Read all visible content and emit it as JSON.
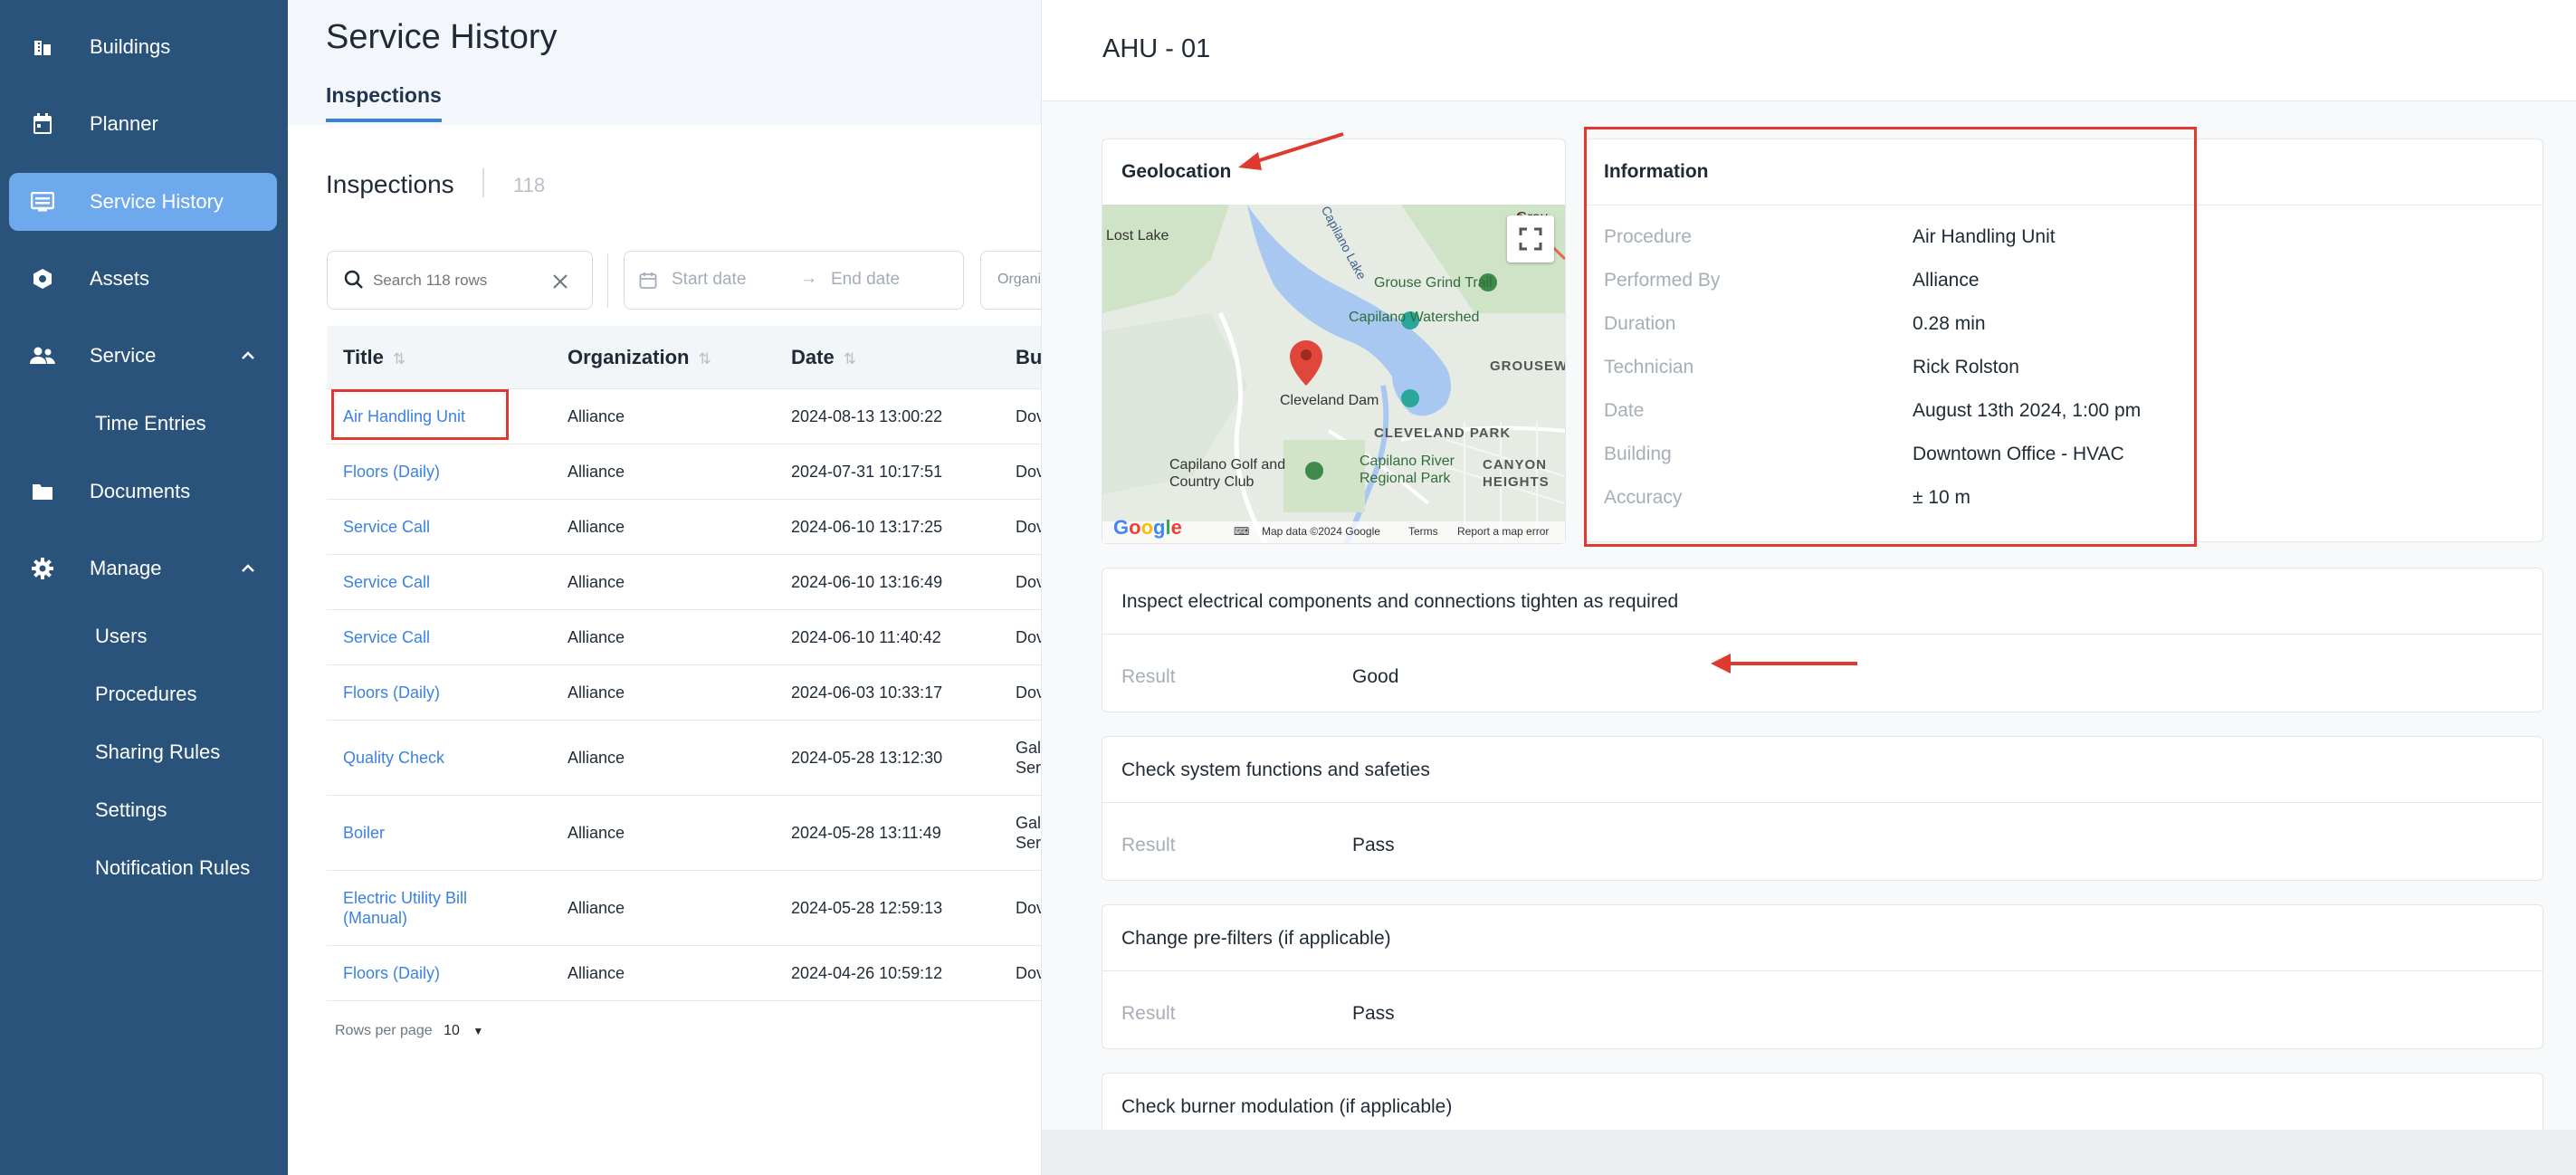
{
  "sidebar": {
    "items": [
      {
        "label": "Buildings",
        "icon": "building-icon"
      },
      {
        "label": "Planner",
        "icon": "calendar-icon"
      },
      {
        "label": "Service History",
        "icon": "history-icon",
        "active": true
      },
      {
        "label": "Assets",
        "icon": "asset-icon"
      },
      {
        "label": "Service",
        "icon": "people-icon",
        "expanded": true
      },
      {
        "label": "Documents",
        "icon": "folder-icon"
      },
      {
        "label": "Manage",
        "icon": "gear-icon",
        "expanded": true
      }
    ],
    "service_sub": [
      "Time Entries"
    ],
    "manage_sub": [
      "Users",
      "Procedures",
      "Sharing Rules",
      "Settings",
      "Notification Rules"
    ],
    "active_color": "#6ea9ee",
    "background": "#2a537c"
  },
  "header": {
    "title": "Service History",
    "tab": "Inspections"
  },
  "list": {
    "title": "Inspections",
    "count": "118",
    "search_placeholder": "Search 118 rows",
    "start_date_placeholder": "Start date",
    "end_date_placeholder": "End date",
    "org_filter": "Organi",
    "columns": [
      "Title",
      "Organization",
      "Date",
      "Bu"
    ],
    "rows": [
      {
        "title": "Air Handling Unit",
        "org": "Alliance",
        "date": "2024-08-13 13:00:22",
        "bu": "Dov"
      },
      {
        "title": "Floors (Daily)",
        "org": "Alliance",
        "date": "2024-07-31 10:17:51",
        "bu": "Dov"
      },
      {
        "title": "Service Call",
        "org": "Alliance",
        "date": "2024-06-10 13:17:25",
        "bu": "Dov"
      },
      {
        "title": "Service Call",
        "org": "Alliance",
        "date": "2024-06-10 13:16:49",
        "bu": "Dov"
      },
      {
        "title": "Service Call",
        "org": "Alliance",
        "date": "2024-06-10 11:40:42",
        "bu": "Dov"
      },
      {
        "title": "Floors (Daily)",
        "org": "Alliance",
        "date": "2024-06-03 10:33:17",
        "bu": "Dov"
      },
      {
        "title": "Quality Check",
        "org": "Alliance",
        "date": "2024-05-28 13:12:30",
        "bu": "Gal Ser"
      },
      {
        "title": "Boiler",
        "org": "Alliance",
        "date": "2024-05-28 13:11:49",
        "bu": "Gal Ser"
      },
      {
        "title": "Electric Utility Bill (Manual)",
        "org": "Alliance",
        "date": "2024-05-28 12:59:13",
        "bu": "Dov"
      },
      {
        "title": "Floors (Daily)",
        "org": "Alliance",
        "date": "2024-04-26 10:59:12",
        "bu": "Dov"
      }
    ],
    "rows_per_page_label": "Rows per page",
    "rows_per_page_value": "10"
  },
  "detail": {
    "title": "AHU - 01",
    "geolocation_title": "Geolocation",
    "map": {
      "labels": [
        "Lost Lake",
        "Capilano Lake",
        "Grouse Grind Trail",
        "Capilano Watershed",
        "GROUSEWOODS",
        "Cleveland Dam",
        "CLEVELAND PARK",
        "Capilano Golf and Country Club",
        "Capilano River Regional Park",
        "CANYON HEIGHTS",
        "Grou"
      ],
      "footer": [
        "Map data ©2024 Google",
        "Terms",
        "Report a map error"
      ],
      "logo": "Google"
    },
    "information_title": "Information",
    "information": [
      {
        "key": "Procedure",
        "value": "Air Handling Unit"
      },
      {
        "key": "Performed By",
        "value": "Alliance"
      },
      {
        "key": "Duration",
        "value": "0.28 min"
      },
      {
        "key": "Technician",
        "value": "Rick Rolston"
      },
      {
        "key": "Date",
        "value": "August 13th 2024, 1:00 pm"
      },
      {
        "key": "Building",
        "value": "Downtown Office - HVAC"
      },
      {
        "key": "Accuracy",
        "value": "± 10 m"
      }
    ],
    "checks": [
      {
        "title": "Inspect electrical components and connections tighten as required",
        "result_label": "Result",
        "result": "Good"
      },
      {
        "title": "Check system functions and safeties",
        "result_label": "Result",
        "result": "Pass"
      },
      {
        "title": "Change pre-filters (if applicable)",
        "result_label": "Result",
        "result": "Pass"
      },
      {
        "title": "Check burner modulation (if applicable)",
        "result_label": "Result",
        "result": ""
      }
    ]
  },
  "colors": {
    "link": "#3b82e0",
    "annotation": "#e03a2e"
  }
}
